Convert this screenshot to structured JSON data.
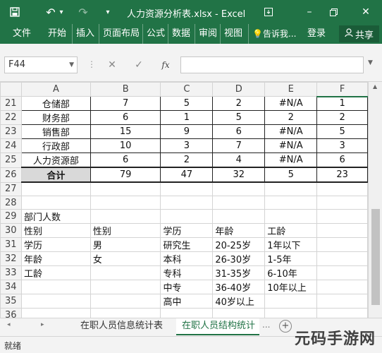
{
  "window": {
    "title": "人力资源分析表.xlsx - Excel",
    "minimize": "–",
    "close": "✕"
  },
  "quick_access": {
    "save_icon": "save-icon",
    "undo": "↶",
    "undo_dd": "▾",
    "redo": "↷",
    "customize": "▾"
  },
  "ribbon": {
    "tabs": [
      "文件",
      "开始",
      "插入",
      "页面布局",
      "公式",
      "数据",
      "审阅",
      "视图"
    ],
    "tell_me": "告诉我...",
    "login": "登录",
    "share": "共享"
  },
  "formula_bar": {
    "name_box": "F44",
    "cancel": "✕",
    "enter": "✓",
    "fx": "fx",
    "value": ""
  },
  "columns": [
    "A",
    "B",
    "C",
    "D",
    "E",
    "F"
  ],
  "rows": [
    {
      "n": "21",
      "cells": [
        "仓储部",
        "7",
        "5",
        "2",
        "#N/A",
        "1"
      ]
    },
    {
      "n": "22",
      "cells": [
        "财务部",
        "6",
        "1",
        "5",
        "2",
        "2"
      ]
    },
    {
      "n": "23",
      "cells": [
        "销售部",
        "15",
        "9",
        "6",
        "#N/A",
        "5"
      ]
    },
    {
      "n": "24",
      "cells": [
        "行政部",
        "10",
        "3",
        "7",
        "#N/A",
        "3"
      ]
    },
    {
      "n": "25",
      "cells": [
        "人力资源部",
        "6",
        "2",
        "4",
        "#N/A",
        "6"
      ]
    },
    {
      "n": "26",
      "cells": [
        "合计",
        "79",
        "47",
        "32",
        "5",
        "23"
      ]
    },
    {
      "n": "27",
      "cells": [
        "",
        "",
        "",
        "",
        "",
        ""
      ]
    },
    {
      "n": "28",
      "cells": [
        "",
        "",
        "",
        "",
        "",
        ""
      ]
    },
    {
      "n": "29",
      "cells": [
        "部门人数",
        "",
        "",
        "",
        "",
        ""
      ]
    },
    {
      "n": "30",
      "cells": [
        "性别",
        "性别",
        "学历",
        "年龄",
        "工龄",
        ""
      ]
    },
    {
      "n": "31",
      "cells": [
        "学历",
        "男",
        "研究生",
        "20-25岁",
        "1年以下",
        ""
      ]
    },
    {
      "n": "32",
      "cells": [
        "年龄",
        "女",
        "本科",
        "26-30岁",
        "1-5年",
        ""
      ]
    },
    {
      "n": "33",
      "cells": [
        "工龄",
        "",
        "专科",
        "31-35岁",
        "6-10年",
        ""
      ]
    },
    {
      "n": "34",
      "cells": [
        "",
        "",
        "中专",
        "36-40岁",
        "10年以上",
        ""
      ]
    },
    {
      "n": "35",
      "cells": [
        "",
        "",
        "高中",
        "40岁以上",
        "",
        ""
      ]
    },
    {
      "n": "36",
      "cells": [
        "",
        "",
        "",
        "",
        "",
        ""
      ]
    }
  ],
  "sheets": {
    "prev": "◂",
    "next": "▸",
    "tabs": [
      "在职人员信息统计表",
      "在职人员结构统计"
    ],
    "more": "...",
    "add": "+"
  },
  "status": {
    "ready": "就绪"
  },
  "watermark": "元码手游网"
}
